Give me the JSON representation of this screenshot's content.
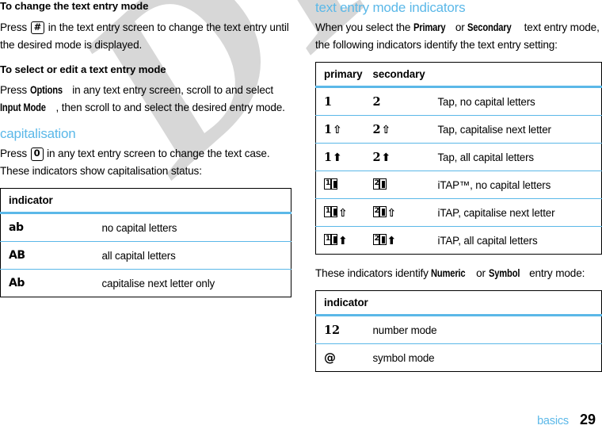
{
  "document": {
    "watermark": "DRAFT",
    "footer": {
      "section": "basics",
      "page_number": "29"
    },
    "accent_color": "#5bb8e8",
    "text_color": "#000000",
    "watermark_color": "#d7d7d7"
  },
  "left_column": {
    "heading_1": "To change the text entry mode",
    "para_1": {
      "before_key": "Press",
      "key": "#",
      "after_key": "in the text entry screen to change the text entry until the desired mode is displayed."
    },
    "heading_2": "To select or edit a text entry mode",
    "para_2": {
      "part_1": "Press",
      "emphasis_1": "Options",
      "part_2": "in any text entry screen, scroll to and select",
      "emphasis_2": "Input Mode",
      "part_3": ", then scroll to and select the desired entry mode."
    },
    "heading_3": "capitalisation",
    "para_3": {
      "before_key": "Press",
      "key": "0",
      "after_key": "in any text entry screen to change the text case. These indicators show capitalisation status:"
    },
    "table": {
      "headers": [
        "indicator",
        ""
      ],
      "rows": [
        {
          "indicator": "ab",
          "description": "no capital letters"
        },
        {
          "indicator": "AB",
          "description": "all capital letters"
        },
        {
          "indicator": "Ab",
          "description": "capitalise next letter only"
        }
      ]
    }
  },
  "right_column": {
    "heading_1": "text entry mode indicators",
    "para_1": {
      "part_1": "When you select the",
      "emphasis_1": "Primary",
      "part_2": "or",
      "emphasis_2": "Secondary",
      "part_3": "text entry mode, the following indicators identify the text entry setting:"
    },
    "table_modes": {
      "headers": [
        "primary",
        "secondary",
        ""
      ],
      "rows": [
        {
          "primary": "1",
          "secondary": "2",
          "modifier": "none",
          "description": "Tap, no capital letters"
        },
        {
          "primary": "1",
          "secondary": "2",
          "modifier": "hollow-up-arrow",
          "description": "Tap, capitalise next letter"
        },
        {
          "primary": "1",
          "secondary": "2",
          "modifier": "solid-up-arrow",
          "description": "Tap, all capital letters"
        },
        {
          "primary": "1",
          "secondary": "2",
          "modifier": "none",
          "icon": "open-book",
          "description": "iTAP™, no capital letters"
        },
        {
          "primary": "1",
          "secondary": "2",
          "modifier": "hollow-up-arrow",
          "icon": "open-book",
          "description": "iTAP, capitalise next letter"
        },
        {
          "primary": "1",
          "secondary": "2",
          "modifier": "solid-up-arrow",
          "icon": "open-book",
          "description": "iTAP, all capital letters"
        }
      ]
    },
    "para_2": {
      "part_1": "These indicators identify",
      "emphasis_1": "Numeric",
      "part_2": "or",
      "emphasis_2": "Symbol",
      "part_3": "entry mode:"
    },
    "table_numsym": {
      "headers": [
        "indicator",
        ""
      ],
      "rows": [
        {
          "indicator": "12",
          "description": "number mode"
        },
        {
          "indicator": "@",
          "description": "symbol mode"
        }
      ]
    }
  }
}
